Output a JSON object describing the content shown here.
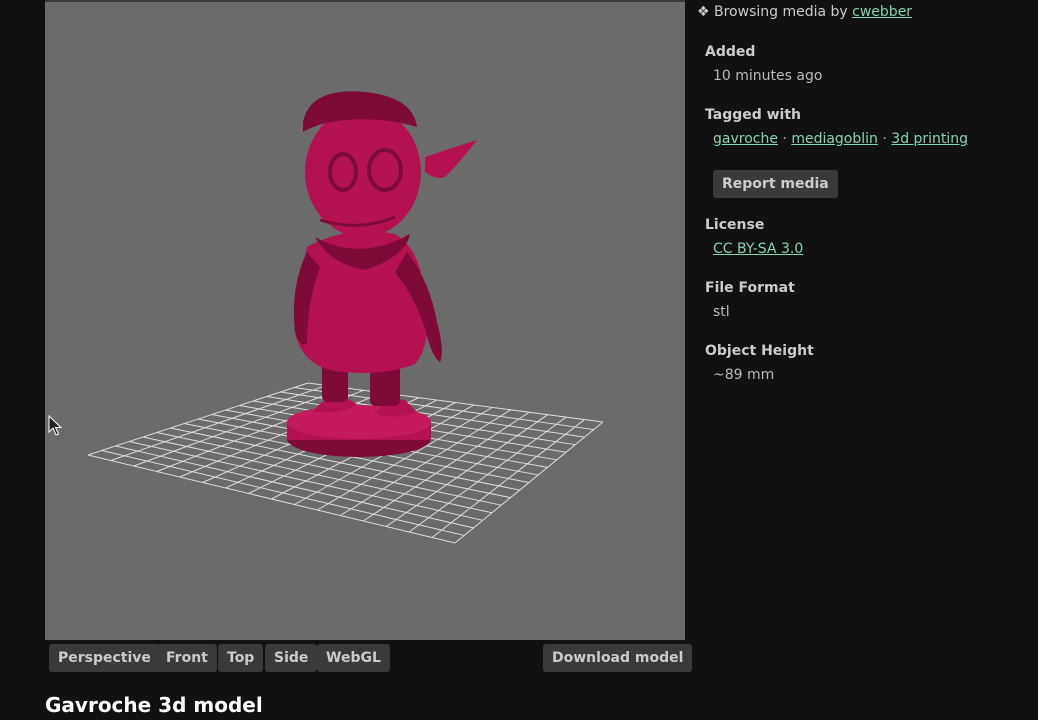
{
  "viewer": {
    "model_color": "#b3114f",
    "background_color": "#6b6b6b",
    "grid_color": "#dddddd"
  },
  "view_buttons": [
    "Perspective",
    "Front",
    "Top",
    "Side",
    "WebGL"
  ],
  "download_label": "Download model",
  "media_title": "Gavroche 3d model",
  "sidebar": {
    "browsing_prefix": "❖ Browsing media by ",
    "browsing_user": "cwebber",
    "added_label": "Added",
    "added_value": "10 minutes ago",
    "tagged_label": "Tagged with",
    "tags": [
      "gavroche",
      "mediagoblin",
      "3d printing"
    ],
    "tag_separator": " · ",
    "report_label": "Report media",
    "license_label": "License",
    "license_value": "CC BY-SA 3.0",
    "format_label": "File Format",
    "format_value": "stl",
    "height_label": "Object Height",
    "height_value": "~89 mm"
  }
}
